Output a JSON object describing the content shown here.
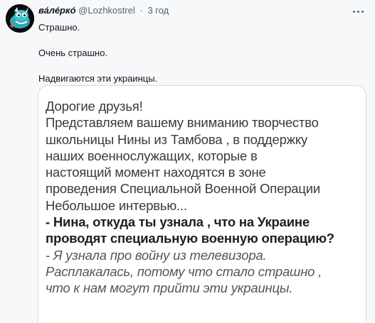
{
  "author": {
    "display_name": "ва́ле́рко́",
    "handle": "@Lozhkostrel",
    "separator": "·",
    "time": "3 год",
    "avatar_icon": "dragon-avatar-icon"
  },
  "tweet": {
    "lines": [
      "Страшно.",
      "Очень страшно.",
      "Надвигаются эти украинцы."
    ]
  },
  "more_icon": "more-dots-icon",
  "card": {
    "lines": [
      {
        "text": "Дорогие друзья!",
        "style": "normal"
      },
      {
        "text": "Представляем вашему вниманию творчество",
        "style": "normal"
      },
      {
        "text": "школьницы  Нины из Тамбова , в поддержку",
        "style": "normal"
      },
      {
        "text": "наших военнослужащих, которые в",
        "style": "normal"
      },
      {
        "text": "настоящий момент находятся  в зоне",
        "style": "normal"
      },
      {
        "text": "проведения Специальной Военной Операции",
        "style": "normal"
      },
      {
        "text": "Небольшое интервью...",
        "style": "normal"
      },
      {
        "text": "- Нина, откуда ты узнала , что на Украине",
        "style": "bold"
      },
      {
        "text": "проводят специальную военную операцию?",
        "style": "bold"
      },
      {
        "text": "- Я узнала про войну из телевизора.",
        "style": "italic"
      },
      {
        "text": "Расплакалась, потому что стало страшно ,",
        "style": "italic"
      },
      {
        "text": "что к нам могут прийти  эти украинцы.",
        "style": "italic"
      }
    ]
  }
}
